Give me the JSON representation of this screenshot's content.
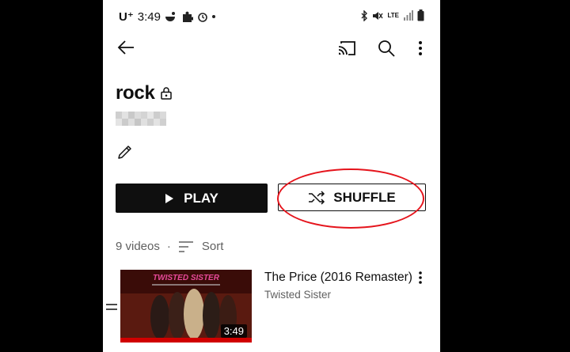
{
  "status_bar": {
    "carrier": "U⁺",
    "time": "3:49",
    "network": "LTE"
  },
  "top_bar": {
    "back_icon": "arrow-left-icon",
    "cast_icon": "cast-icon",
    "search_icon": "search-icon",
    "more_icon": "more-vert-icon"
  },
  "playlist": {
    "title": "rock",
    "privacy_icon": "lock-icon",
    "edit_icon": "pencil-icon"
  },
  "buttons": {
    "play_label": "PLAY",
    "shuffle_label": "SHUFFLE"
  },
  "list_header": {
    "video_count": "9 videos",
    "separator": "·",
    "sort_label": "Sort"
  },
  "videos": [
    {
      "title": "The Price (2016 Remaster)",
      "channel": "Twisted Sister",
      "duration": "3:49",
      "thumbnail_text": "TWISTED SISTER"
    }
  ],
  "colors": {
    "background": "#ffffff",
    "frame": "#000000",
    "play_button": "#0f0f0f",
    "annotation": "#e5141c",
    "secondary_text": "#606060"
  }
}
